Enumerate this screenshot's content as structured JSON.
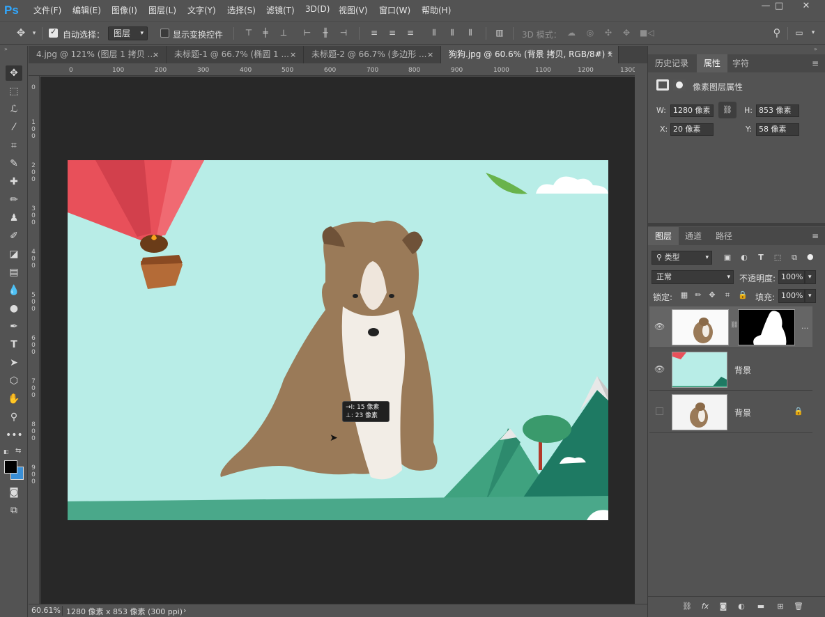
{
  "app": {
    "logo": "Ps"
  },
  "menu": [
    "文件(F)",
    "编辑(E)",
    "图像(I)",
    "图层(L)",
    "文字(Y)",
    "选择(S)",
    "滤镜(T)",
    "3D(D)",
    "视图(V)",
    "窗口(W)",
    "帮助(H)"
  ],
  "window_controls": {
    "minimize": "—",
    "maximize": "□",
    "close": "✕"
  },
  "options": {
    "auto_select_label": "自动选择：",
    "auto_select_checked": true,
    "auto_select_target": "图层",
    "show_transform_label": "显示变换控件",
    "show_transform_checked": false,
    "mode_3d_label": "3D 模式："
  },
  "tabs": [
    {
      "label": "4.jpg @ 121% (图层 1 拷贝 ...",
      "close": "×",
      "active": false
    },
    {
      "label": "未标题-1 @ 66.7% (椭圆 1 ...",
      "close": "×",
      "active": false
    },
    {
      "label": "未标题-2 @ 66.7% (多边形 ...",
      "close": "×",
      "active": false
    },
    {
      "label": "狗狗.jpg @ 60.6% (背景 拷贝, RGB/8#) *",
      "close": "×",
      "active": true
    }
  ],
  "ruler_top": [
    "0",
    "100",
    "200",
    "300",
    "400",
    "500",
    "600",
    "700",
    "800",
    "900",
    "1000",
    "1100",
    "1200",
    "1300"
  ],
  "ruler_left": [
    "0",
    "100",
    "200",
    "300",
    "400",
    "500",
    "600",
    "700",
    "800",
    "900"
  ],
  "tooltip": {
    "line1": "→I: 15 像素",
    "line2": "⊥: 23 像素"
  },
  "status": {
    "zoom": "60.61%",
    "doc_info": "1280 像素 x 853 像素 (300 ppi)",
    "arrow": "›"
  },
  "panels_top": {
    "tabs": [
      "历史记录",
      "属性",
      "字符"
    ],
    "active_tab": "属性",
    "header": "像素图层属性",
    "w_label": "W:",
    "w_value": "1280 像素",
    "h_label": "H:",
    "h_value": "853 像素",
    "x_label": "X:",
    "x_value": "20 像素",
    "y_label": "Y:",
    "y_value": "58 像素"
  },
  "layers_panel": {
    "tabs": [
      "图层",
      "通道",
      "路径"
    ],
    "active_tab": "图层",
    "filter_kind": "类型",
    "blend_mode": "正常",
    "opacity_label": "不透明度:",
    "opacity_value": "100%",
    "lock_label": "锁定:",
    "fill_label": "填充:",
    "fill_value": "100%",
    "layers": [
      {
        "name": "",
        "visible": true,
        "selected": true,
        "has_mask": true,
        "more": "..."
      },
      {
        "name": "背景",
        "visible": true,
        "selected": false
      },
      {
        "name": "背景",
        "visible": false,
        "selected": false,
        "locked": true
      }
    ]
  },
  "colors": {
    "accent": "#31a8ff",
    "canvas_bg": "#b8ede7",
    "balloon": "#e8505a",
    "mountain_dark": "#1e7a63",
    "mountain_light": "#3fa27f",
    "ground": "#4aa88a"
  }
}
